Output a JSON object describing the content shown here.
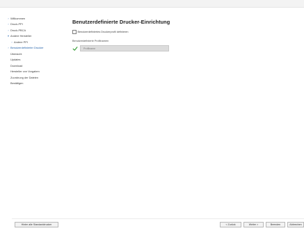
{
  "sidebar": {
    "items": [
      {
        "label": "Willkommen"
      },
      {
        "label": "Druck-PPI"
      },
      {
        "label": "Druck-PBCA"
      },
      {
        "label": "Andere Hersteller"
      },
      {
        "label": "Andere PPI"
      },
      {
        "label": "Benutzerdefinierter Drucker"
      },
      {
        "label": "Übersicht"
      },
      {
        "label": "Updates"
      },
      {
        "label": "Download"
      },
      {
        "label": "Hersteller von Vorgaben"
      },
      {
        "label": "Zuordnung der Dateien"
      },
      {
        "label": "Bestätigen"
      }
    ]
  },
  "main": {
    "title": "Benutzerdefinierte Drucker-Einrichtung",
    "checkbox_label": "Benutzerdefiniertes Druckerprofil definieren",
    "profiles_label": "Benutzerdefinierte Profilnamen",
    "profile_placeholder": "Profilname"
  },
  "footer": {
    "config_button": "Hinter alle Standarddrucker",
    "back_button": "< Zurück",
    "next_button": "Weiter >",
    "finish_button": "Beenden",
    "cancel_button": "Abbrechen"
  },
  "colors": {
    "check_green": "#3aa13a",
    "active_blue": "#1f5fa8"
  }
}
